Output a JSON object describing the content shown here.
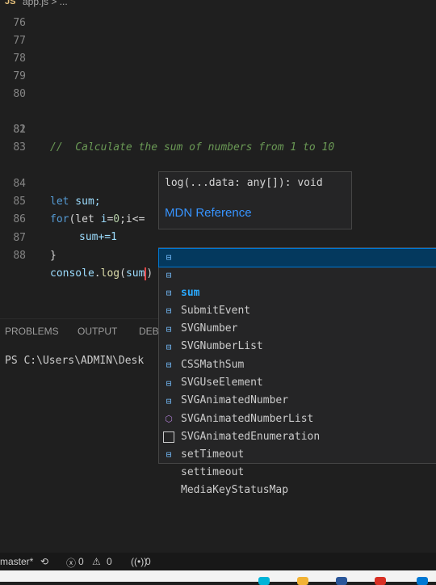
{
  "breadcrumb": {
    "file_icon": "JS",
    "path": "app.js > ..."
  },
  "editor": {
    "lines": [
      {
        "n": "76"
      },
      {
        "n": "77"
      },
      {
        "n": "78"
      },
      {
        "n": "79"
      },
      {
        "n": "80"
      },
      {
        "n": "81",
        "comment": "//  Calculate the sum of numbers from 1 to 10"
      },
      {
        "n": "82"
      },
      {
        "n": "83"
      },
      {
        "n": "84",
        "kw": "let",
        "rest": " sum;"
      },
      {
        "n": "85",
        "kw": "for",
        "rest": "(let ",
        "v": "i",
        "eq": "=",
        "zero": "0",
        "tail": ";i<="
      },
      {
        "n": "86",
        "body": "sum+=1"
      },
      {
        "n": "87",
        "brace": "}"
      },
      {
        "n": "88",
        "obj": "console",
        "dot": ".",
        "fn": "log",
        "paren": "(",
        "arg": "sum",
        "close": ")"
      }
    ]
  },
  "hover": {
    "signature": "log(...data: any[]): void",
    "reference": "MDN Reference"
  },
  "panel": {
    "tabs": [
      "PROBLEMS",
      "OUTPUT",
      "DEB"
    ],
    "terminal": "PS C:\\Users\\ADMIN\\Desk"
  },
  "suggestions": [
    {
      "icon": "variable-icon",
      "pre": "",
      "hl": "sum",
      "post": ""
    },
    {
      "icon": "variable-icon",
      "pre": "",
      "hl": "S",
      "mid": "",
      "label": "SubmitEvent"
    },
    {
      "icon": "variable-icon",
      "label": "SVGNumber"
    },
    {
      "icon": "variable-icon",
      "label": "SVGNumberList"
    },
    {
      "icon": "variable-icon",
      "label": "CSSMathSum"
    },
    {
      "icon": "variable-icon",
      "label": "SVGUseElement"
    },
    {
      "icon": "variable-icon",
      "label": "SVGAnimatedNumber"
    },
    {
      "icon": "variable-icon",
      "label": "SVGAnimatedNumberList"
    },
    {
      "icon": "variable-icon",
      "label": "SVGAnimatedEnumeration"
    },
    {
      "icon": "method-icon",
      "label": "setTimeout"
    },
    {
      "icon": "text-icon",
      "label": "settimeout"
    },
    {
      "icon": "variable-icon",
      "label": "MediaKeyStatusMap"
    }
  ],
  "statusbar": {
    "branch": "master*",
    "errors": "0",
    "warnings": "0",
    "ports": "0"
  },
  "colors": {
    "accent": "#0078d4",
    "highlight": "#2aaaff",
    "link": "#3794ff"
  }
}
